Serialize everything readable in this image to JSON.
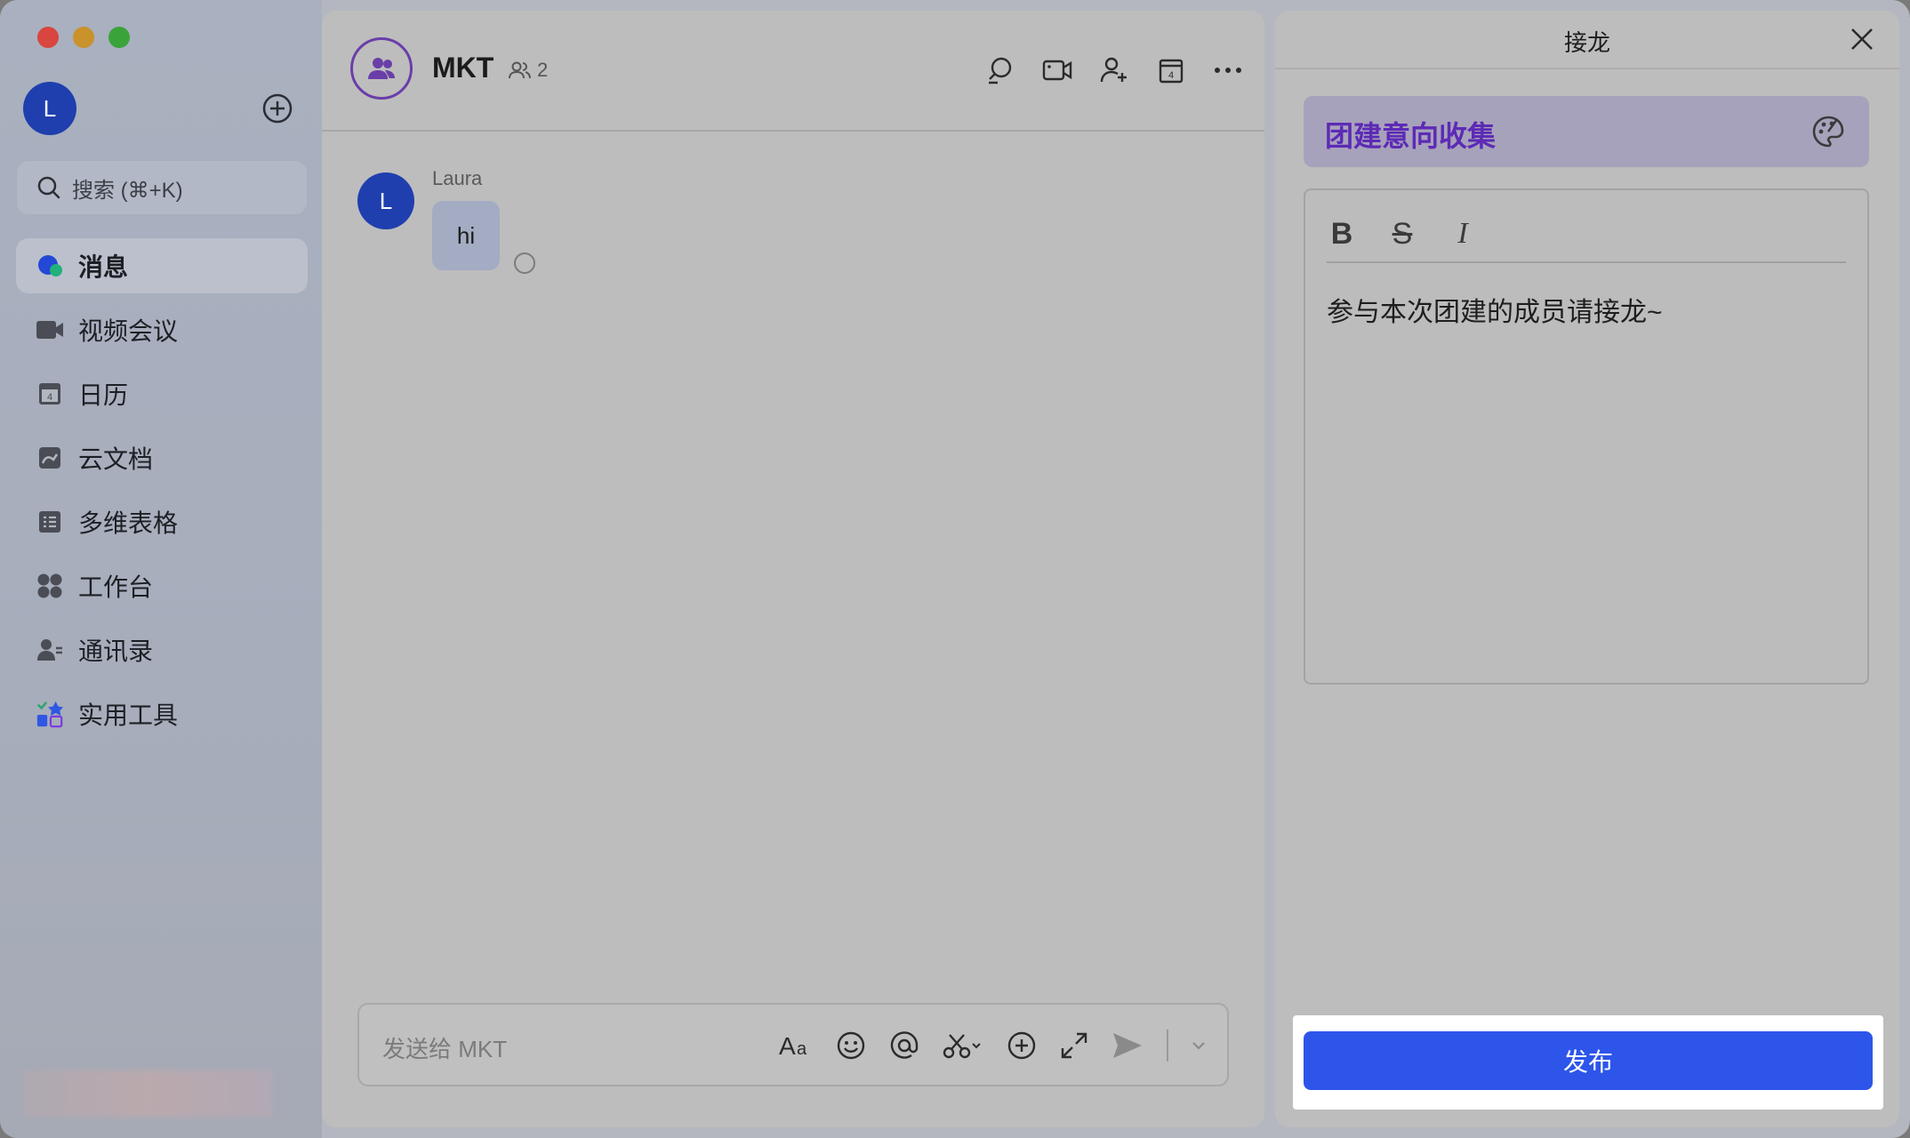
{
  "sidebar": {
    "avatar_initial": "L",
    "search_placeholder": "搜索 (⌘+K)",
    "items": [
      {
        "label": "消息",
        "icon": "message-icon",
        "active": true
      },
      {
        "label": "视频会议",
        "icon": "video-meeting-icon"
      },
      {
        "label": "日历",
        "icon": "calendar-icon"
      },
      {
        "label": "云文档",
        "icon": "cloud-doc-icon"
      },
      {
        "label": "多维表格",
        "icon": "base-table-icon"
      },
      {
        "label": "工作台",
        "icon": "workplace-icon"
      },
      {
        "label": "通讯录",
        "icon": "contacts-icon"
      },
      {
        "label": "实用工具",
        "icon": "tools-icon"
      }
    ]
  },
  "chat": {
    "title": "MKT",
    "member_count": "2",
    "messages": [
      {
        "sender": "Laura",
        "avatar_initial": "L",
        "text": "hi"
      }
    ],
    "composer_placeholder": "发送给 MKT"
  },
  "relay": {
    "title": "接龙",
    "theme_title": "团建意向收集",
    "body_text": "参与本次团建的成员请接龙~",
    "toolbar": {
      "bold": "B",
      "strike": "S",
      "italic": "I"
    },
    "publish_label": "发布"
  },
  "colors": {
    "accent": "#2d55ea",
    "avatar": "#1f3fae",
    "theme_text": "#5d2ab6"
  }
}
